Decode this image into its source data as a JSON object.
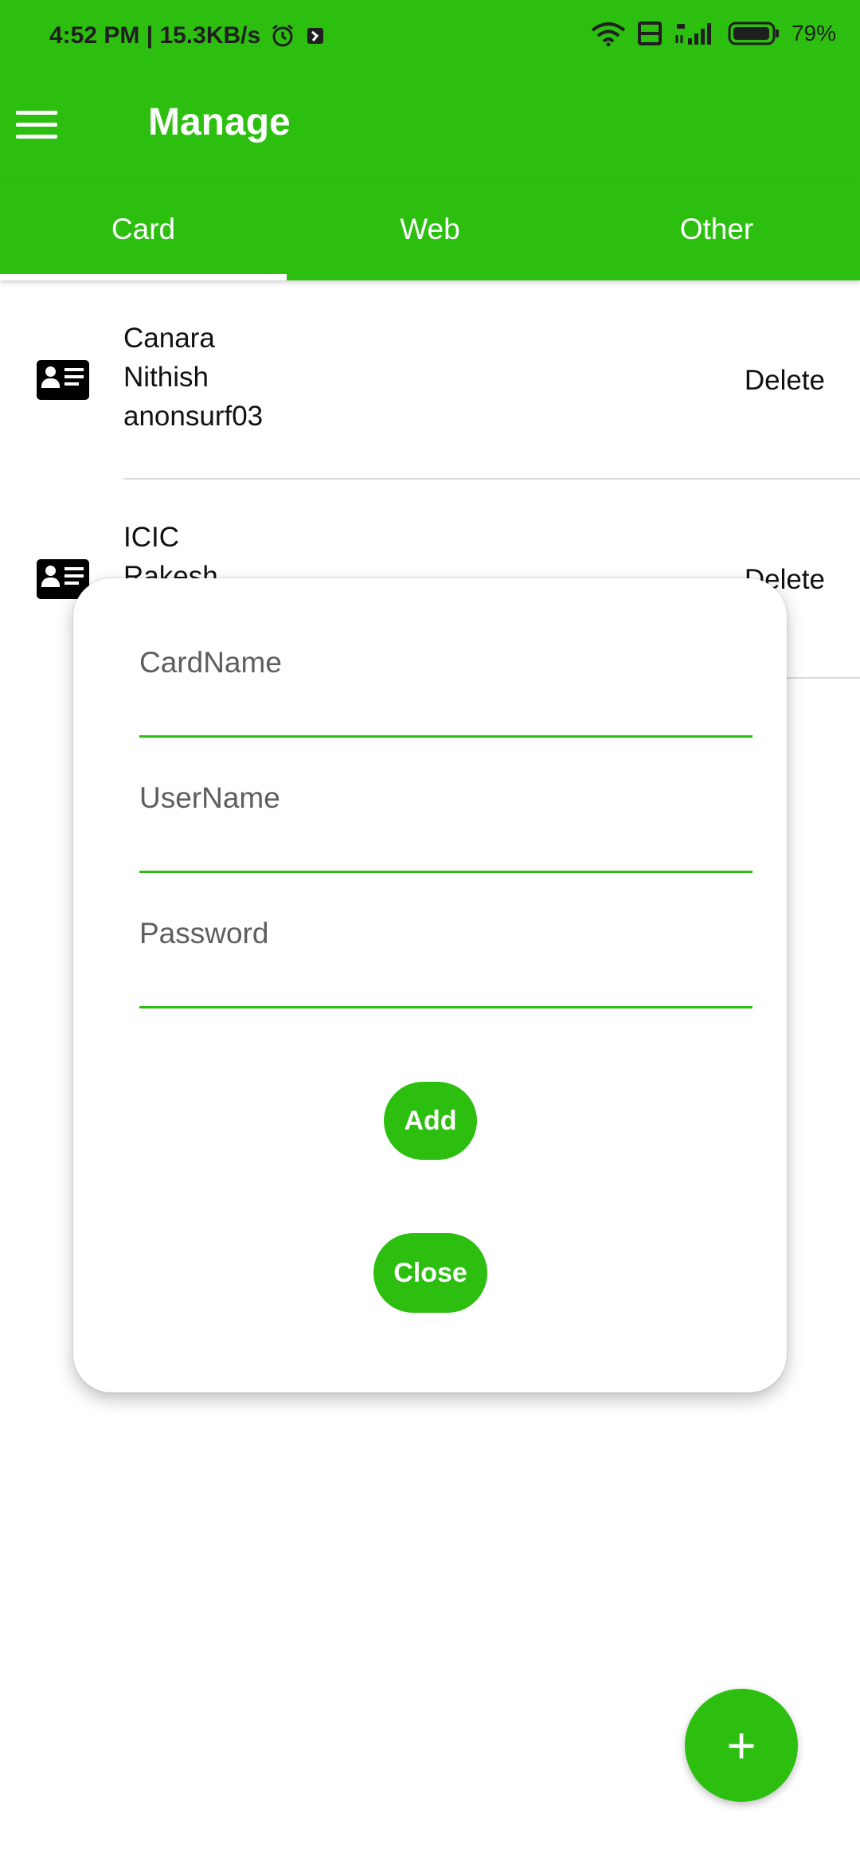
{
  "status_bar": {
    "left_text": "4:52 PM | 15.3KB/s",
    "battery": "79%",
    "icons": [
      "alarm-icon",
      "notification-icon",
      "wifi-icon",
      "volte-icon",
      "signal-4g-icon",
      "battery-icon"
    ]
  },
  "app_bar": {
    "title": "Manage",
    "menu_icon": "hamburger-menu-icon"
  },
  "tabs": [
    {
      "label": "Card",
      "active": true
    },
    {
      "label": "Web",
      "active": false
    },
    {
      "label": "Other",
      "active": false
    }
  ],
  "list": [
    {
      "line1": "Canara",
      "line2": "Nithish",
      "line3": "anonsurf03",
      "action": "Delete",
      "icon": "id-card-icon"
    },
    {
      "line1": "ICIC",
      "line2": "Rakesh",
      "line3": "",
      "action": "Delete",
      "icon": "id-card-icon"
    }
  ],
  "dialog": {
    "fields": [
      {
        "label": "CardName",
        "value": ""
      },
      {
        "label": "UserName",
        "value": ""
      },
      {
        "label": "Password",
        "value": ""
      }
    ],
    "add_label": "Add",
    "close_label": "Close"
  },
  "fab": {
    "label": "+",
    "icon": "plus-icon"
  },
  "colors": {
    "accent": "#2dbf10",
    "background": "#ffffff",
    "text": "#111111"
  }
}
